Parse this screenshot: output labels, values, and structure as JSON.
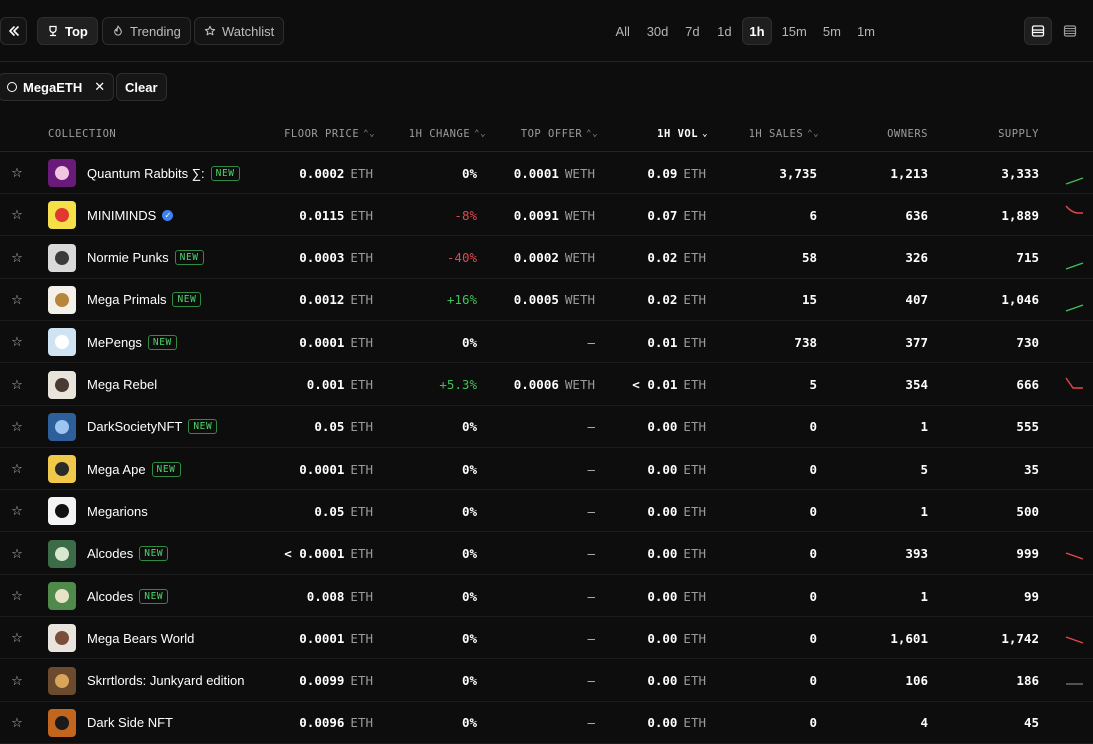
{
  "toolbar": {
    "tabs": [
      {
        "label": "Top",
        "icon": "trophy-icon",
        "active": true
      },
      {
        "label": "Trending",
        "icon": "flame-icon",
        "active": false
      },
      {
        "label": "Watchlist",
        "icon": "star-icon",
        "active": false
      }
    ],
    "time_ranges": [
      "All",
      "30d",
      "7d",
      "1d",
      "1h",
      "15m",
      "5m",
      "1m"
    ],
    "time_active": "1h"
  },
  "filters": {
    "chip_label": "MegaETH",
    "clear_label": "Clear"
  },
  "table": {
    "headers": {
      "collection": "COLLECTION",
      "floor": "FLOOR PRICE",
      "change": "1H CHANGE",
      "offer": "TOP OFFER",
      "vol": "1H VOL",
      "sales": "1H SALES",
      "owners": "OWNERS",
      "supply": "SUPPLY"
    },
    "badge_label": "NEW",
    "rows": [
      {
        "name": "Quantum Rabbits ∑:",
        "new": true,
        "verified": false,
        "floor": "0.0002",
        "floor_unit": "ETH",
        "change": "0%",
        "change_dir": "flat",
        "offer": "0.0001",
        "offer_unit": "WETH",
        "vol": "0.09",
        "vol_unit": "ETH",
        "sales": "3,735",
        "owners": "1,213",
        "supply": "3,333",
        "spark": "up",
        "thumb_bg": "#6a1b7a",
        "thumb_fg": "#f2c6e0"
      },
      {
        "name": "MINIMINDS",
        "new": false,
        "verified": true,
        "floor": "0.0115",
        "floor_unit": "ETH",
        "change": "-8%",
        "change_dir": "down",
        "offer": "0.0091",
        "offer_unit": "WETH",
        "vol": "0.07",
        "vol_unit": "ETH",
        "sales": "6",
        "owners": "636",
        "supply": "1,889",
        "spark": "down-curve",
        "thumb_bg": "#f5e04a",
        "thumb_fg": "#e0392f"
      },
      {
        "name": "Normie Punks",
        "new": true,
        "verified": false,
        "floor": "0.0003",
        "floor_unit": "ETH",
        "change": "-40%",
        "change_dir": "down",
        "offer": "0.0002",
        "offer_unit": "WETH",
        "vol": "0.02",
        "vol_unit": "ETH",
        "sales": "58",
        "owners": "326",
        "supply": "715",
        "spark": "up",
        "thumb_bg": "#d9d9d9",
        "thumb_fg": "#3a3a3a"
      },
      {
        "name": "Mega Primals",
        "new": true,
        "verified": false,
        "floor": "0.0012",
        "floor_unit": "ETH",
        "change": "+16%",
        "change_dir": "up",
        "offer": "0.0005",
        "offer_unit": "WETH",
        "vol": "0.02",
        "vol_unit": "ETH",
        "sales": "15",
        "owners": "407",
        "supply": "1,046",
        "spark": "up",
        "thumb_bg": "#f4f1ea",
        "thumb_fg": "#b8863b"
      },
      {
        "name": "MePengs",
        "new": true,
        "verified": false,
        "floor": "0.0001",
        "floor_unit": "ETH",
        "change": "0%",
        "change_dir": "flat",
        "offer": "–",
        "offer_unit": "",
        "vol": "0.01",
        "vol_unit": "ETH",
        "sales": "738",
        "owners": "377",
        "supply": "730",
        "spark": "none",
        "thumb_bg": "#cfe3f2",
        "thumb_fg": "#ffffff"
      },
      {
        "name": "Mega Rebel",
        "new": false,
        "verified": false,
        "floor": "0.001",
        "floor_unit": "ETH",
        "change": "+5.3%",
        "change_dir": "up",
        "offer": "0.0006",
        "offer_unit": "WETH",
        "vol": "< 0.01",
        "vol_unit": "ETH",
        "sales": "5",
        "owners": "354",
        "supply": "666",
        "spark": "down-steep",
        "thumb_bg": "#e8e4dc",
        "thumb_fg": "#4a3b32"
      },
      {
        "name": "DarkSocietyNFT",
        "new": true,
        "verified": false,
        "floor": "0.05",
        "floor_unit": "ETH",
        "change": "0%",
        "change_dir": "flat",
        "offer": "–",
        "offer_unit": "",
        "vol": "0.00",
        "vol_unit": "ETH",
        "sales": "0",
        "owners": "1",
        "supply": "555",
        "spark": "none",
        "thumb_bg": "#2d5f9a",
        "thumb_fg": "#9cc5ef"
      },
      {
        "name": "Mega Ape",
        "new": true,
        "verified": false,
        "floor": "0.0001",
        "floor_unit": "ETH",
        "change": "0%",
        "change_dir": "flat",
        "offer": "–",
        "offer_unit": "",
        "vol": "0.00",
        "vol_unit": "ETH",
        "sales": "0",
        "owners": "5",
        "supply": "35",
        "spark": "none",
        "thumb_bg": "#f1c94a",
        "thumb_fg": "#2a2a2a"
      },
      {
        "name": "Megarions",
        "new": false,
        "verified": false,
        "floor": "0.05",
        "floor_unit": "ETH",
        "change": "0%",
        "change_dir": "flat",
        "offer": "–",
        "offer_unit": "",
        "vol": "0.00",
        "vol_unit": "ETH",
        "sales": "0",
        "owners": "1",
        "supply": "500",
        "spark": "none",
        "thumb_bg": "#f4f4f4",
        "thumb_fg": "#111111"
      },
      {
        "name": "Alcodes",
        "new": true,
        "verified": false,
        "floor": "< 0.0001",
        "floor_unit": "ETH",
        "change": "0%",
        "change_dir": "flat",
        "offer": "–",
        "offer_unit": "",
        "vol": "0.00",
        "vol_unit": "ETH",
        "sales": "0",
        "owners": "393",
        "supply": "999",
        "spark": "down",
        "thumb_bg": "#3b6b47",
        "thumb_fg": "#d8e8d0"
      },
      {
        "name": "Alcodes",
        "new": true,
        "verified": false,
        "floor": "0.008",
        "floor_unit": "ETH",
        "change": "0%",
        "change_dir": "flat",
        "offer": "–",
        "offer_unit": "",
        "vol": "0.00",
        "vol_unit": "ETH",
        "sales": "0",
        "owners": "1",
        "supply": "99",
        "spark": "none",
        "thumb_bg": "#4f8a4a",
        "thumb_fg": "#e8e2c8"
      },
      {
        "name": "Mega Bears World",
        "new": false,
        "verified": false,
        "floor": "0.0001",
        "floor_unit": "ETH",
        "change": "0%",
        "change_dir": "flat",
        "offer": "–",
        "offer_unit": "",
        "vol": "0.00",
        "vol_unit": "ETH",
        "sales": "0",
        "owners": "1,601",
        "supply": "1,742",
        "spark": "down",
        "thumb_bg": "#e9e4de",
        "thumb_fg": "#7a4f38"
      },
      {
        "name": "Skrrtlords: Junkyard edition",
        "new": false,
        "verified": false,
        "floor": "0.0099",
        "floor_unit": "ETH",
        "change": "0%",
        "change_dir": "flat",
        "offer": "–",
        "offer_unit": "",
        "vol": "0.00",
        "vol_unit": "ETH",
        "sales": "0",
        "owners": "106",
        "supply": "186",
        "spark": "flat",
        "thumb_bg": "#6b4a2e",
        "thumb_fg": "#d8a55a"
      },
      {
        "name": "Dark Side NFT",
        "new": false,
        "verified": false,
        "floor": "0.0096",
        "floor_unit": "ETH",
        "change": "0%",
        "change_dir": "flat",
        "offer": "–",
        "offer_unit": "",
        "vol": "0.00",
        "vol_unit": "ETH",
        "sales": "0",
        "owners": "4",
        "supply": "45",
        "spark": "none",
        "thumb_bg": "#c2651e",
        "thumb_fg": "#1a1a1a"
      }
    ]
  }
}
